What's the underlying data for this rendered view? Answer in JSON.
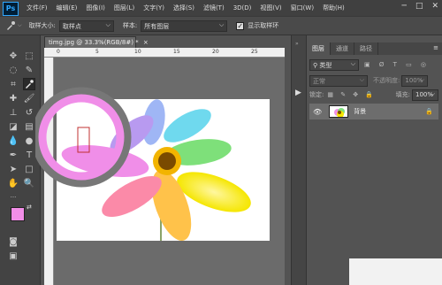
{
  "app": {
    "logo": "Ps"
  },
  "menubar": {
    "items": [
      "文件(F)",
      "编辑(E)",
      "图像(I)",
      "图层(L)",
      "文字(Y)",
      "选择(S)",
      "滤镜(T)",
      "3D(D)",
      "视图(V)",
      "窗口(W)",
      "帮助(H)"
    ],
    "window_controls": [
      "─",
      "□",
      "✕"
    ]
  },
  "optionsbar": {
    "sample_size_label": "取样大小:",
    "sample_size_value": "取样点",
    "sample_label": "样本:",
    "sample_value": "所有图层",
    "show_ring_label": "显示取样环",
    "show_ring_checked": true
  },
  "document": {
    "tab_title": "timg.jpg @ 33.3%(RGB/8#) *",
    "tab_close": "×",
    "ruler_marks": [
      "0",
      "5",
      "10",
      "15",
      "20",
      "25"
    ]
  },
  "colors": {
    "foreground": "#f28ee8",
    "background": "#ffffff",
    "sample_ring_top": "#f08ee8",
    "sample_ring_outer": "#777777"
  },
  "layers_panel": {
    "tabs": [
      "图层",
      "通道",
      "路径"
    ],
    "active_tab": "图层",
    "kind_label": "类型",
    "blend_mode": "正常",
    "opacity_label": "不透明度:",
    "opacity_value": "100%",
    "lock_label": "锁定:",
    "fill_label": "填充:",
    "fill_value": "100%",
    "layers": [
      {
        "name": "背景",
        "visible": true,
        "locked": true
      }
    ]
  }
}
